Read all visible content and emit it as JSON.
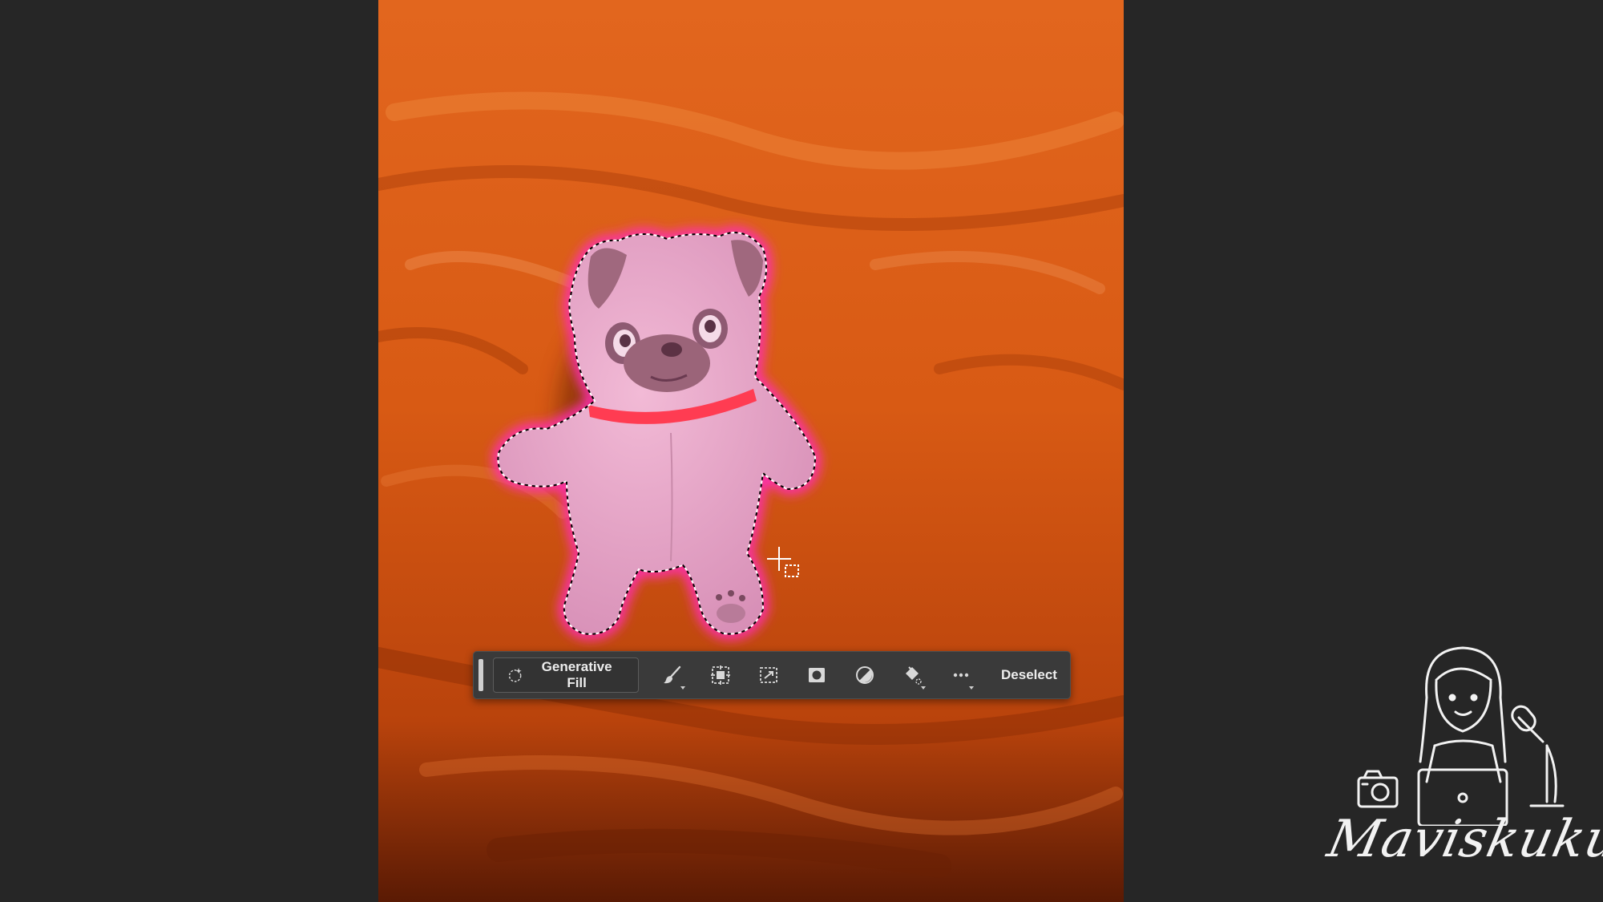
{
  "taskbar": {
    "generative_fill_label": "Generative Fill",
    "deselect_label": "Deselect",
    "tools": [
      {
        "name": "brush-icon",
        "has_dropdown": true
      },
      {
        "name": "select-subject-icon",
        "has_dropdown": false
      },
      {
        "name": "transform-selection-icon",
        "has_dropdown": false
      },
      {
        "name": "mask-icon",
        "has_dropdown": false
      },
      {
        "name": "adjustment-layer-icon",
        "has_dropdown": false
      },
      {
        "name": "fill-bucket-icon",
        "has_dropdown": true
      },
      {
        "name": "more-options-icon",
        "has_dropdown": true
      }
    ]
  },
  "watermark": {
    "text": "Maviskuku"
  },
  "colors": {
    "workspace_bg": "#262626",
    "canvas_orange": "#c8500f",
    "selection_glow": "#ff2fb4",
    "toy_pink": "#e8a3c8",
    "taskbar_bg": "#3a3a3a",
    "icon_color": "#d8d8d8"
  }
}
